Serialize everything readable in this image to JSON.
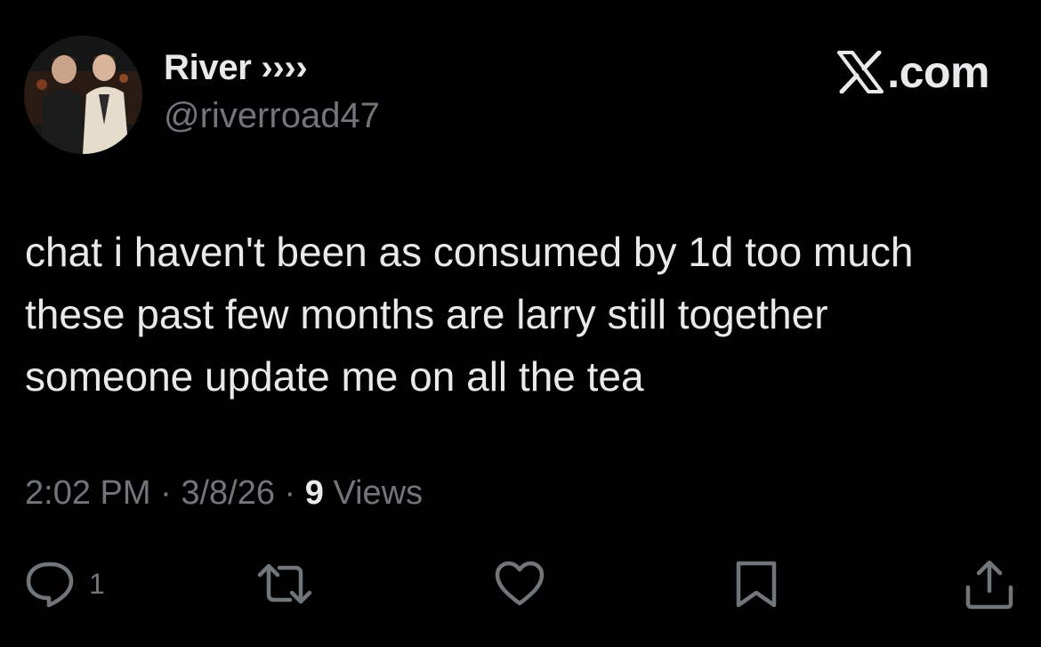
{
  "user": {
    "display_name": "River ››››",
    "handle": "@riverroad47"
  },
  "site": {
    "label": ".com",
    "icon": "x-logo-icon"
  },
  "post": {
    "text": "chat i haven't been as consumed by 1d too much\nthese past few months are larry still together\nsomeone update me on all the tea",
    "time": "2:02 PM",
    "date": "3/8/26",
    "views_count": "9",
    "views_label": "Views",
    "separator": "·"
  },
  "actions": {
    "reply": {
      "icon": "reply-bubble-icon",
      "count": "1"
    },
    "repost": {
      "icon": "repost-icon"
    },
    "like": {
      "icon": "heart-icon"
    },
    "bookmark": {
      "icon": "bookmark-icon"
    },
    "share": {
      "icon": "share-icon"
    }
  },
  "colors": {
    "background": "#000000",
    "primary_text": "#e7e9ea",
    "secondary_text": "#71767b"
  }
}
